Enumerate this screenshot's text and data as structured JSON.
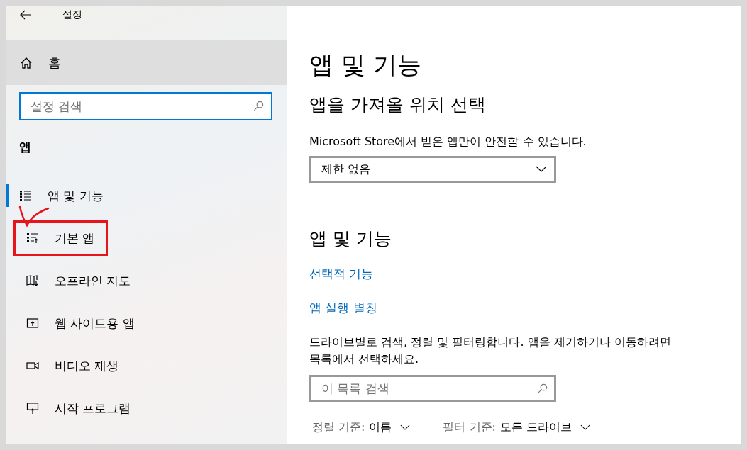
{
  "window": {
    "title": "설정"
  },
  "sidebar": {
    "home": {
      "label": "홈",
      "highlighted": true
    },
    "search": {
      "placeholder": "설정 검색"
    },
    "section": "앱",
    "items": [
      {
        "label": "앱 및 기능",
        "selected": true,
        "annotated": false
      },
      {
        "label": "기본 앱",
        "selected": false,
        "annotated": true
      },
      {
        "label": "오프라인 지도",
        "selected": false,
        "annotated": false
      },
      {
        "label": "웹 사이트용 앱",
        "selected": false,
        "annotated": false
      },
      {
        "label": "비디오 재생",
        "selected": false,
        "annotated": false
      },
      {
        "label": "시작 프로그램",
        "selected": false,
        "annotated": false
      }
    ]
  },
  "main": {
    "title": "앱 및 기능",
    "source_heading": "앱을 가져올 위치 선택",
    "source_text": "Microsoft Store에서 받은 앱만이 안전할 수 있습니다.",
    "source_dropdown": "제한 없음",
    "features_heading": "앱 및 기능",
    "links": [
      "선택적 기능",
      "앱 실행 별칭"
    ],
    "description": "드라이브별로 검색, 정렬 및 필터링합니다. 앱을 제거하거나 이동하려면 목록에서 선택하세요.",
    "list_search": {
      "placeholder": "이 목록 검색"
    },
    "sort": {
      "label": "정렬 기준:",
      "value": "이름"
    },
    "filter": {
      "label": "필터 기준:",
      "value": "모든 드라이브"
    }
  }
}
